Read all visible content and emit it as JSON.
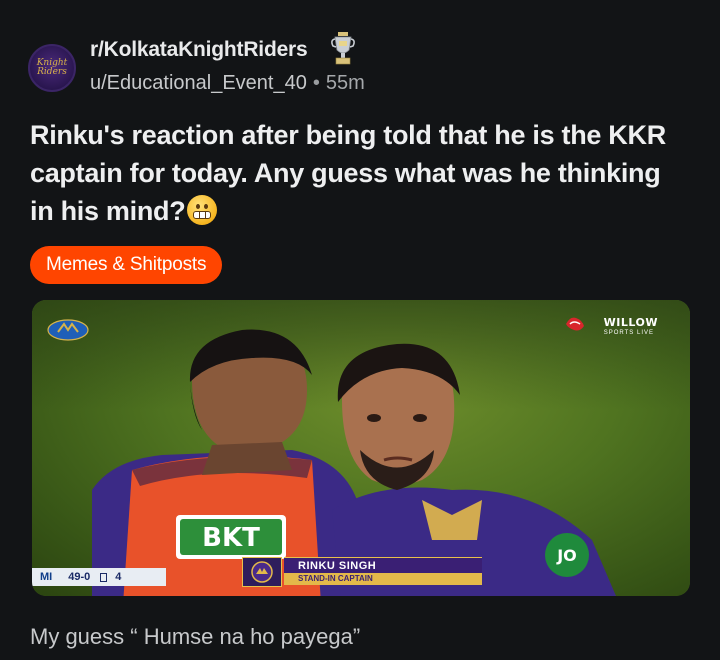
{
  "post": {
    "subreddit": "r/KolkataKnightRiders",
    "author": "u/Educational_Event_40",
    "separator": "•",
    "age": "55m",
    "avatar_text": "Knight Riders",
    "title": "Rinku's reaction after being told that he is the KKR captain for today. Any guess what was he thinking in his mind?",
    "flair": "Memes & Shitposts",
    "body": "My guess “ Humse na ho payega”"
  },
  "media": {
    "broadcaster": "WILLOW",
    "broadcaster_sub": "SPORTS LIVE",
    "score": {
      "team": "MI",
      "runs": "49-0",
      "overs": "4"
    },
    "caption_name": "RINKU SINGH",
    "caption_role": "STAND-IN CAPTAIN",
    "jersey_sponsor": "BKT"
  },
  "colors": {
    "background": "#121416",
    "flair_bg": "#ff4500",
    "kkr_purple": "#3a1f74",
    "kkr_gold": "#e3b94a"
  }
}
